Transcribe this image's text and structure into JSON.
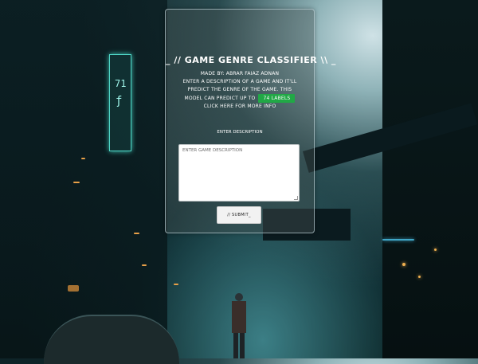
{
  "header": {
    "title": "_ // GAME GENRE CLASSIFIER \\\\ _"
  },
  "intro": {
    "made_by": "MADE BY: ABRAR FAIAZ ADNAN",
    "line1": "ENTER A DESCRIPTION OF A GAME AND IT'LL",
    "line2": "PREDICT THE GENRE OF THE GAME. THIS",
    "line3_prefix": "MODEL CAN PREDICT UP TO",
    "labels_badge": "74 LABELS",
    "more_info_link": "CLICK HERE FOR MORE INFO"
  },
  "form": {
    "label": "ENTER DESCRIPTION",
    "placeholder": "ENTER GAME DESCRIPTION",
    "submit_label": "// SUBMIT_"
  },
  "colors": {
    "badge": "#21a846",
    "card_border": "#bed2d7",
    "background_dark": "#0c2226"
  }
}
